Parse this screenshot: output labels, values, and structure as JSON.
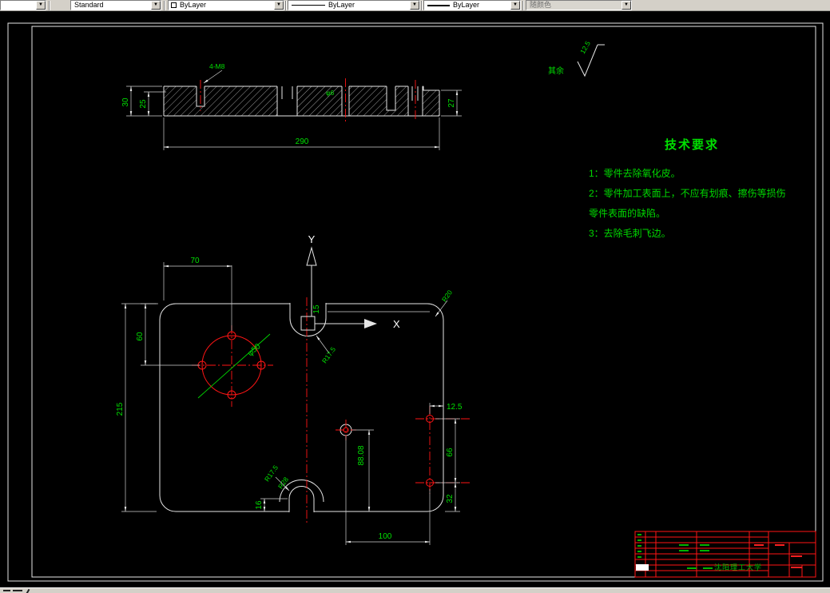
{
  "toolbar": {
    "layer_value": "",
    "style_value": "Standard",
    "color_value": "ByLayer",
    "linetype_value": "ByLayer",
    "lineweight_value": "ByLayer",
    "plot_style_value": "随颜色"
  },
  "surface_finish": {
    "value": "12.5",
    "scope_label": "其余"
  },
  "tech": {
    "title": "技术要求",
    "items": [
      "1：零件去除氧化皮。",
      "2：零件加工表面上，不应有划痕、擦伤等损伤",
      "零件表面的缺陷。",
      "3：去除毛刺飞边。"
    ]
  },
  "section_view": {
    "callout": "4-M8",
    "hole_label": "φ6",
    "dims": {
      "w290": "290",
      "h30": "30",
      "h25": "25",
      "h27": "27"
    }
  },
  "plan_view": {
    "axis_x": "X",
    "axis_y": "Y",
    "dims": {
      "d70": "70",
      "d60": "60",
      "d215": "215",
      "d125": "12.5",
      "d66": "66",
      "d32": "32",
      "d16": "16",
      "d88": "88.08",
      "d100": "100",
      "d15": "15",
      "phi50": "φ50",
      "r20": "R20",
      "r17_top": "R17.5",
      "r17_bottom": "R17.5",
      "r28": "R28"
    }
  },
  "title_block": {
    "university": "沈阳理工大学"
  },
  "colors": {
    "dimension_text": "#00e000",
    "geometry": "#ffffff",
    "centerline": "#ff0000",
    "canvas": "#000000"
  }
}
